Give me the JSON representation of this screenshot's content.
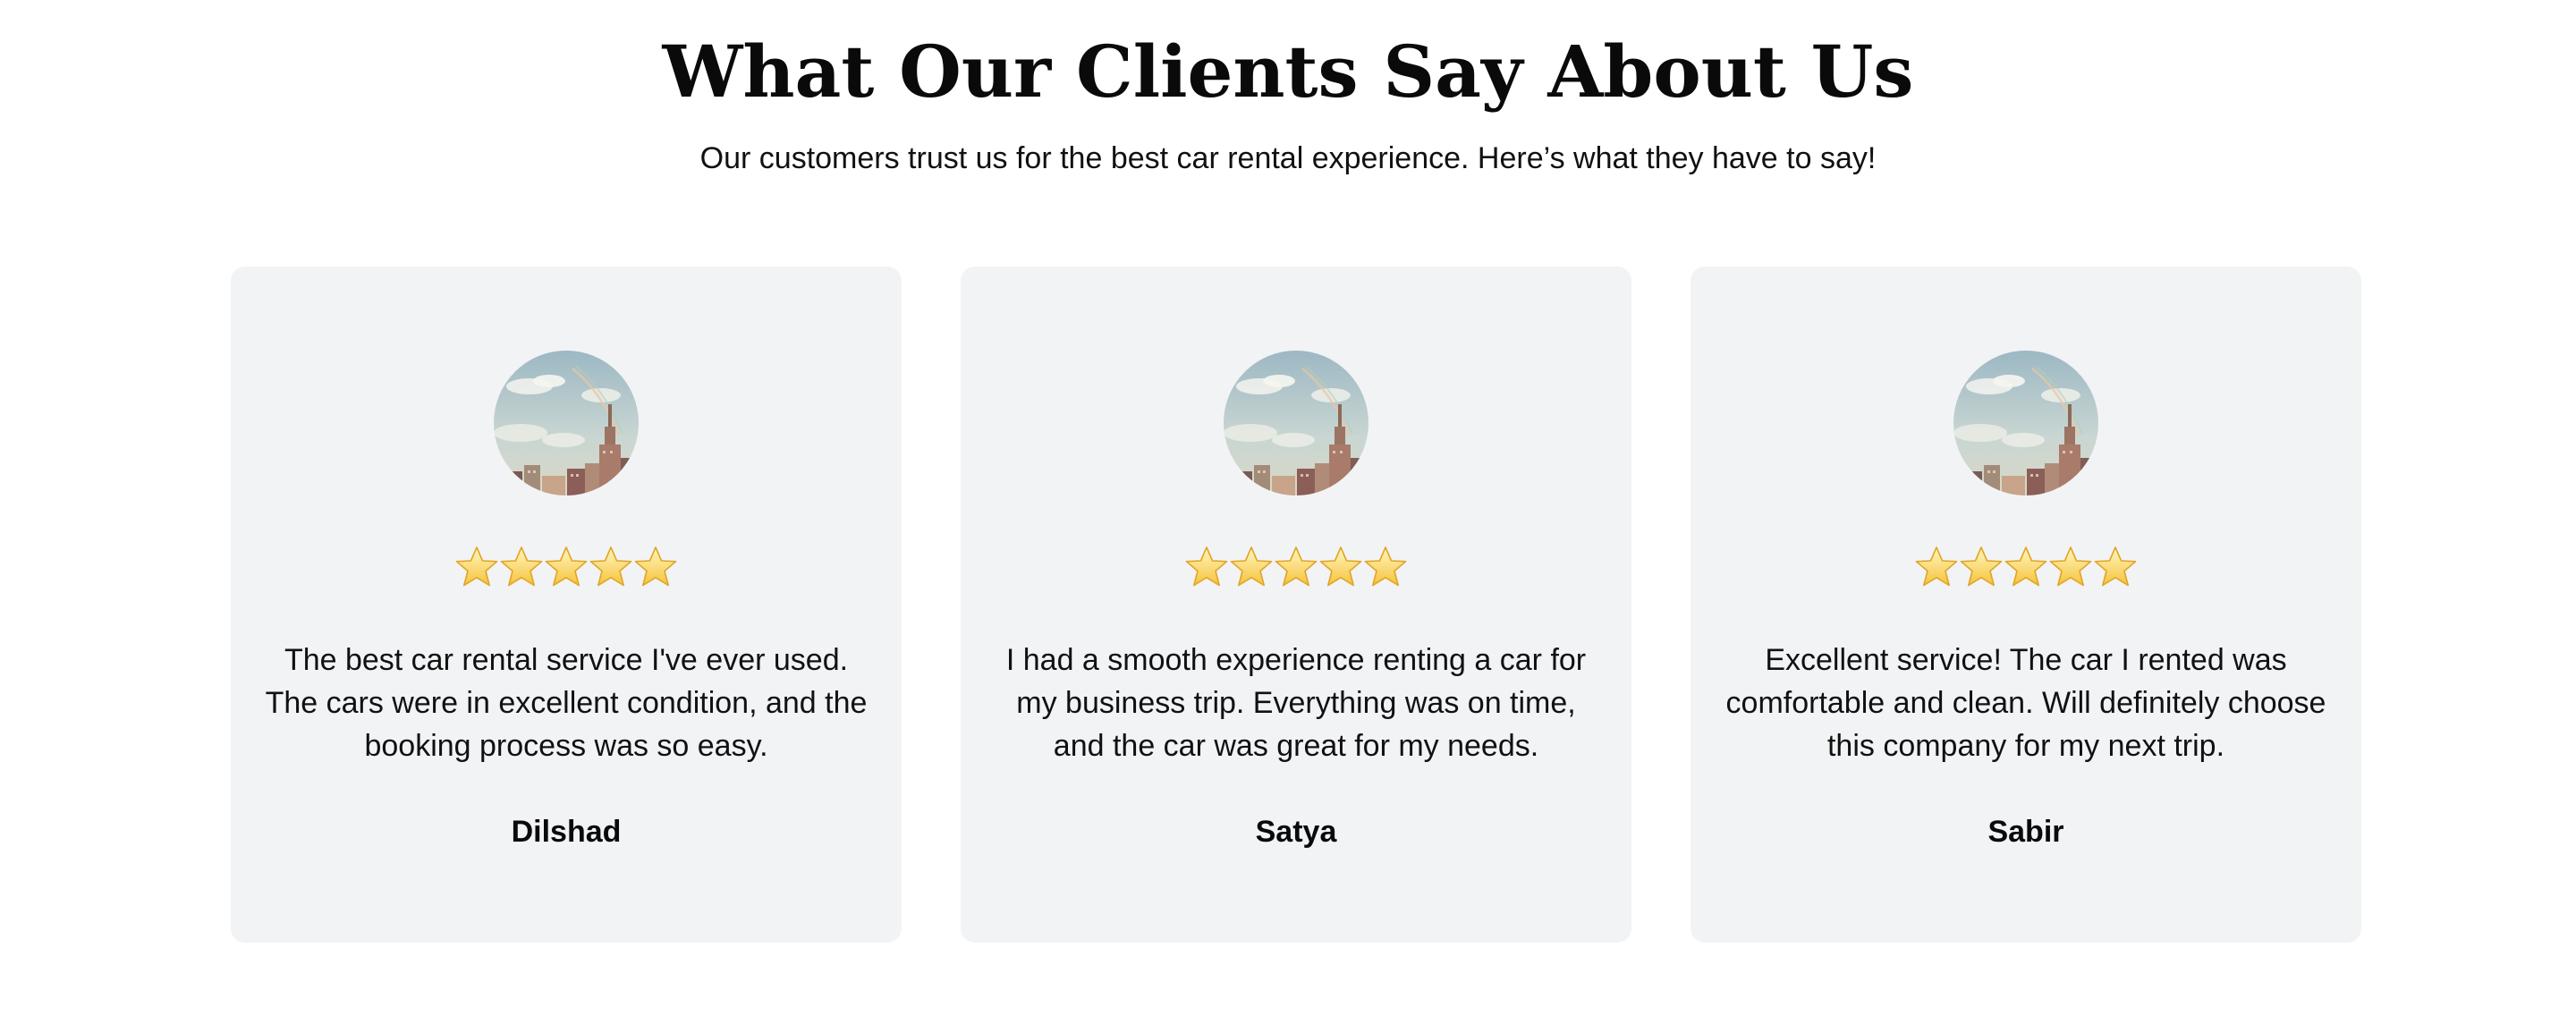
{
  "header": {
    "title": "What Our Clients Say About Us",
    "subtitle": "Our customers trust us for the best car rental experience. Here’s what they have to say!"
  },
  "testimonials": [
    {
      "rating": 5,
      "quote": "The best car rental service I've ever used. The cars were in excellent condition, and the booking process was so easy.",
      "name": "Dilshad"
    },
    {
      "rating": 5,
      "quote": "I had a smooth experience renting a car for my business trip. Everything was on time, and the car was great for my needs.",
      "name": "Satya"
    },
    {
      "rating": 5,
      "quote": "Excellent service! The car I rented was comfortable and clean. Will definitely choose this company for my next trip.",
      "name": "Sabir"
    }
  ],
  "icons": {
    "avatar": "city-skyline-photo",
    "rating": "star-icon"
  },
  "colors": {
    "card_background": "#f2f3f5",
    "star_fill": "#f7c948",
    "text": "#111111"
  }
}
